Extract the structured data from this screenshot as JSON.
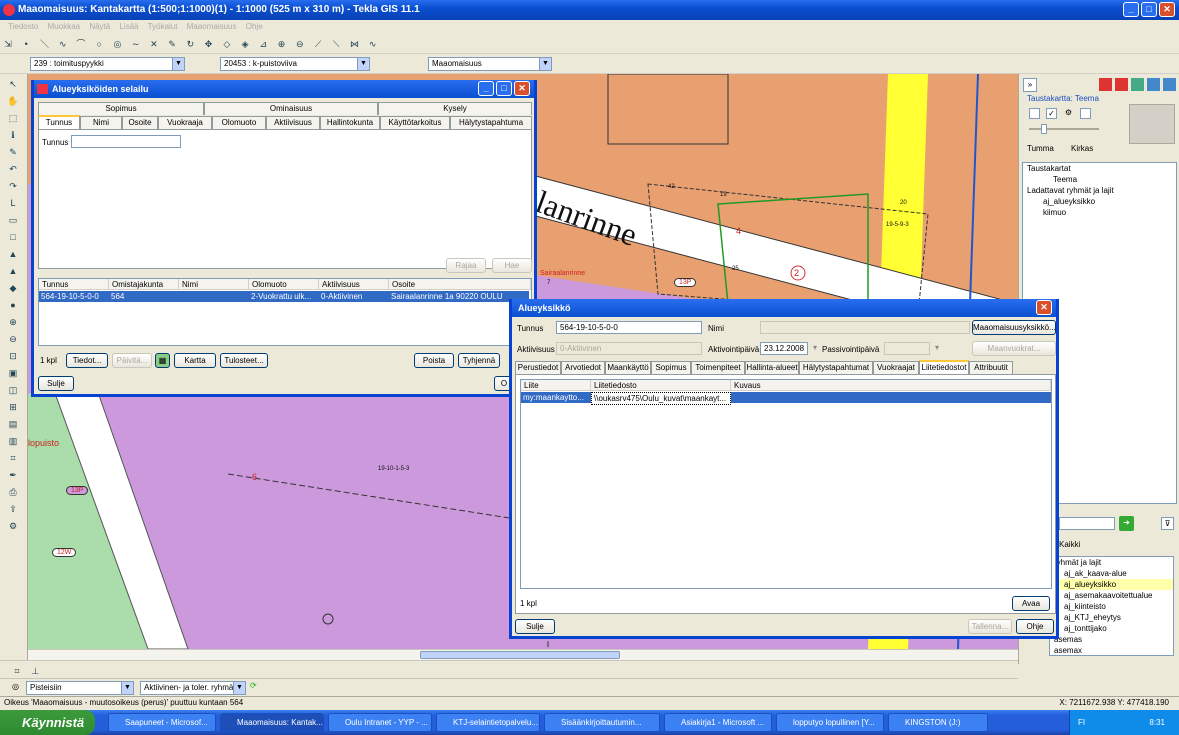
{
  "window": {
    "title": "Maaomaisuus: Kantakartta (1:500;1:1000)(1) - 1:1000 (525 m x 310 m) - Tekla GIS 11.1"
  },
  "menu": [
    "Tiedosto",
    "Muokkaa",
    "Näytä",
    "Lisää",
    "Työkalut",
    "Maaomaisuus",
    "Ohje"
  ],
  "toolbar2": {
    "combo1": "239 : toimituspyykki",
    "combo2": "20453 : k-puistoviiva",
    "combo3": "Maaomaisuus"
  },
  "map": {
    "labels": {
      "street": "lanrinne",
      "street_left": "lopuisto",
      "num6": "6",
      "num4": "4",
      "num2": "2",
      "num25": "25",
      "num19": "19",
      "num42": "42",
      "num7": "7",
      "num20": "20",
      "parcel1": "19-10-1-5-3",
      "parcel2": "19-5-9-3",
      "code1": "13P",
      "code2": "12W",
      "code3": "13P",
      "saira": "Sairaalanrinne"
    }
  },
  "right": {
    "taustakartta": "Taustakartta: Teema",
    "tumma": "Tumma",
    "kirkas": "Kirkas",
    "tree1": [
      "Taustakartat",
      "Teema",
      "Ladattavat ryhmät ja lajit",
      "aj_alueyksikko",
      "kiimuo"
    ],
    "kaikki": "Kaikki",
    "tree2": [
      "ryhmät ja lajit",
      "aj_ak_kaava-alue",
      "aj_alueyksikko",
      "aj_asemakaavoitettualue",
      "aj_kiinteisto",
      "aj_KTJ_eheytys",
      "aj_tonttijako",
      "asemas",
      "asemax"
    ]
  },
  "bottombar": {
    "combo1": "Pisteisiin",
    "combo2": "Aktiivinen- ja toler. ryhmä"
  },
  "status": {
    "text": "Oikeus 'Maaomaisuus - muutosoikeus (perus)' puuttuu kuntaan 564",
    "coords": "X: 7211672.938  Y: 477418.190"
  },
  "taskbar": {
    "start": "Käynnistä",
    "tasks": [
      "Saapuneet - Microsof...",
      "Maaomaisuus: Kantak...",
      "Oulu Intranet - YYP - ...",
      "KTJ-selaintietopalvelu...",
      "Sisäänkirjoittautumin...",
      "Asiakirja1 - Microsoft ...",
      "lopputyo lopullinen [Y...",
      "KINGSTON (J:)"
    ],
    "lang": "FI",
    "time": "8:31"
  },
  "dlg1": {
    "title": "Alueyksiköiden selailu",
    "groups": [
      "Sopimus",
      "Ominaisuus",
      "Kysely"
    ],
    "tabs": [
      "Tunnus",
      "Nimi",
      "Osoite",
      "Vuokraaja",
      "Olomuoto",
      "Aktiivisuus",
      "Hallintokunta",
      "Käyttötarkoitus",
      "Hälytystapahtuma"
    ],
    "tunnus_label": "Tunnus",
    "rajaa": "Rajaa",
    "hae": "Hae",
    "columns": [
      "Tunnus",
      "Omistajakunta",
      "Nimi",
      "Olomuoto",
      "Aktiivisuus",
      "Osoite"
    ],
    "row": [
      "564-19-10-5-0-0",
      "564",
      "",
      "2-Vuokrattu ulk...",
      "0-Aktiivinen",
      "Sairaalanrinne 1a 90220 OULU"
    ],
    "count": "1 kpl",
    "tiedot": "Tiedot...",
    "paivita": "Päivitä...",
    "kartta": "Kartta",
    "tulosteet": "Tulosteet...",
    "poista": "Poista",
    "tyhjenna": "Tyhjennä",
    "sulje": "Sulje",
    "o": "O"
  },
  "dlg2": {
    "title": "Alueyksikkö",
    "tunnus_label": "Tunnus",
    "tunnus": "564-19-10-5-0-0",
    "nimi_label": "Nimi",
    "maaom_btn": "Maaomaisuusyksikkö...",
    "aktiivisuus_label": "Aktiivisuus",
    "aktiivisuus": "0-Aktiivinen",
    "aktiv_label": "Aktivointipäivä",
    "aktiv_date": "23.12.2008",
    "passiv_label": "Passivointipäivä",
    "maanvuokrat": "Maanvuokrat...",
    "tabs": [
      "Perustiedot",
      "Arvotiedot",
      "Maankäyttö",
      "Sopimus",
      "Toimenpiteet",
      "Hallinta-alueet",
      "Hälytystapahtumat",
      "Vuokraajat",
      "Liitetiedostot",
      "Attribuutit"
    ],
    "columns": [
      "Liite",
      "Liitetiedosto",
      "Kuvaus"
    ],
    "row": [
      "my:maankaytto...",
      "\\\\oukasrv475\\Oulu_kuvat\\maankayt...",
      ""
    ],
    "count": "1 kpl",
    "avaa": "Avaa",
    "sulje": "Sulje",
    "tallenna": "Tallenna...",
    "ohje": "Ohje"
  }
}
